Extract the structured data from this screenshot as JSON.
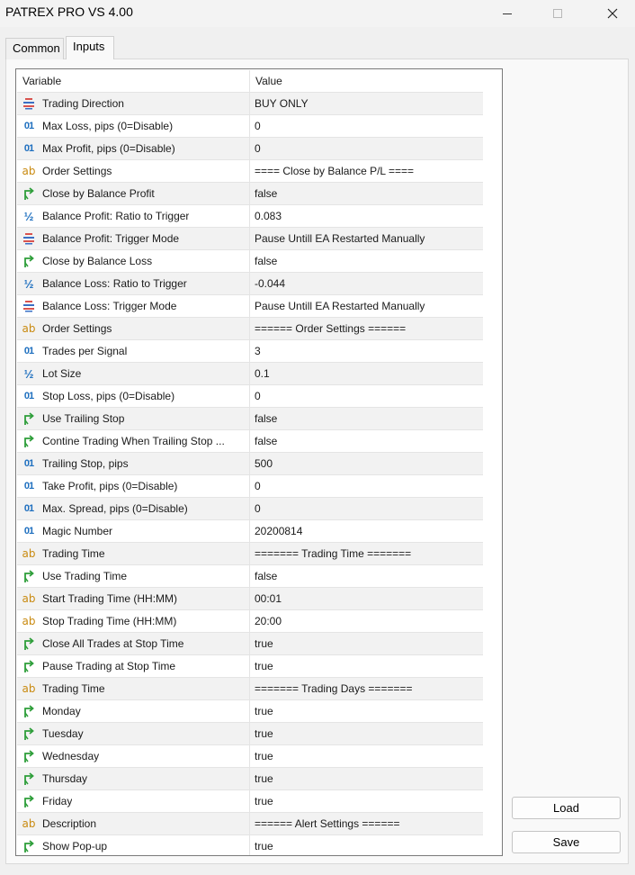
{
  "window": {
    "title": "PATREX PRO VS 4.00"
  },
  "tabs": {
    "common": "Common",
    "inputs": "Inputs"
  },
  "table": {
    "headers": {
      "variable": "Variable",
      "value": "Value"
    },
    "rows": [
      {
        "icon": "enum-icon",
        "label": "Trading Direction",
        "value": "BUY ONLY"
      },
      {
        "icon": "integer-icon",
        "label": "Max Loss, pips (0=Disable)",
        "value": "0"
      },
      {
        "icon": "integer-icon",
        "label": "Max Profit, pips (0=Disable)",
        "value": "0"
      },
      {
        "icon": "string-icon",
        "label": "Order Settings",
        "value": "==== Close by Balance P/L ===="
      },
      {
        "icon": "bool-icon",
        "label": "Close by Balance Profit",
        "value": "false"
      },
      {
        "icon": "double-icon",
        "label": "Balance Profit: Ratio to Trigger",
        "value": "0.083"
      },
      {
        "icon": "enum-icon",
        "label": "Balance Profit: Trigger Mode",
        "value": "Pause Untill EA Restarted Manually"
      },
      {
        "icon": "bool-icon",
        "label": "Close by Balance Loss",
        "value": "false"
      },
      {
        "icon": "double-icon",
        "label": "Balance Loss: Ratio to Trigger",
        "value": "-0.044"
      },
      {
        "icon": "enum-icon",
        "label": "Balance Loss: Trigger Mode",
        "value": "Pause Untill EA Restarted Manually"
      },
      {
        "icon": "string-icon",
        "label": "Order Settings",
        "value": "====== Order Settings ======"
      },
      {
        "icon": "integer-icon",
        "label": "Trades per Signal",
        "value": "3"
      },
      {
        "icon": "double-icon",
        "label": "Lot Size",
        "value": "0.1"
      },
      {
        "icon": "integer-icon",
        "label": "Stop Loss, pips (0=Disable)",
        "value": "0"
      },
      {
        "icon": "bool-icon",
        "label": "Use Trailing Stop",
        "value": "false"
      },
      {
        "icon": "bool-icon",
        "label": "Contine Trading When Trailing Stop ...",
        "value": "false"
      },
      {
        "icon": "integer-icon",
        "label": "Trailing Stop, pips",
        "value": "500"
      },
      {
        "icon": "integer-icon",
        "label": "Take Profit, pips (0=Disable)",
        "value": "0"
      },
      {
        "icon": "integer-icon",
        "label": "Max. Spread, pips (0=Disable)",
        "value": "0"
      },
      {
        "icon": "integer-icon",
        "label": "Magic Number",
        "value": "20200814"
      },
      {
        "icon": "string-icon",
        "label": "Trading Time",
        "value": "======= Trading Time ======="
      },
      {
        "icon": "bool-icon",
        "label": "Use Trading Time",
        "value": "false"
      },
      {
        "icon": "string-icon",
        "label": "Start Trading Time (HH:MM)",
        "value": "00:01"
      },
      {
        "icon": "string-icon",
        "label": "Stop Trading Time (HH:MM)",
        "value": "20:00"
      },
      {
        "icon": "bool-icon",
        "label": "Close All Trades at Stop Time",
        "value": "true"
      },
      {
        "icon": "bool-icon",
        "label": "Pause Trading at Stop Time",
        "value": "true"
      },
      {
        "icon": "string-icon",
        "label": "Trading Time",
        "value": "======= Trading Days ======="
      },
      {
        "icon": "bool-icon",
        "label": "Monday",
        "value": "true"
      },
      {
        "icon": "bool-icon",
        "label": "Tuesday",
        "value": "true"
      },
      {
        "icon": "bool-icon",
        "label": "Wednesday",
        "value": "true"
      },
      {
        "icon": "bool-icon",
        "label": "Thursday",
        "value": "true"
      },
      {
        "icon": "bool-icon",
        "label": "Friday",
        "value": "true"
      },
      {
        "icon": "string-icon",
        "label": "Description",
        "value": "====== Alert Settings ======"
      },
      {
        "icon": "bool-icon",
        "label": "Show Pop-up",
        "value": "true"
      }
    ]
  },
  "buttons": {
    "load": "Load",
    "save": "Save"
  }
}
